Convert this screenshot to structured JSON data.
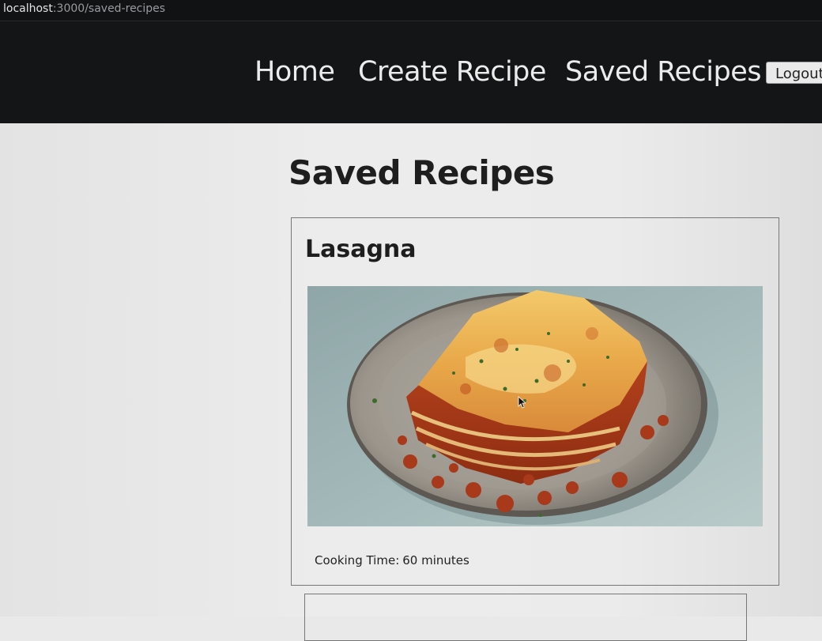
{
  "browser": {
    "url_host": "localhost",
    "url_path": ":3000/saved-recipes"
  },
  "nav": {
    "home": "Home",
    "create_recipe": "Create Recipe",
    "saved_recipes": "Saved Recipes",
    "logout": "Logout"
  },
  "page": {
    "title": "Saved Recipes"
  },
  "recipes": [
    {
      "name": "Lasagna",
      "image": "lasagna-photo",
      "cooking_time_label": "Cooking Time:",
      "cooking_time": "60 minutes"
    }
  ],
  "colors": {
    "navbar": "#141517",
    "background": "#ebebeb",
    "text": "#1e1e1e"
  }
}
